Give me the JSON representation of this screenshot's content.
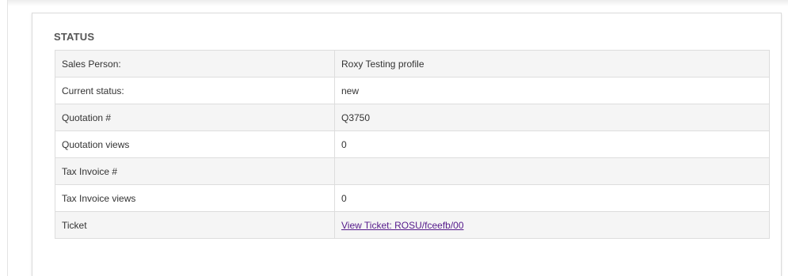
{
  "status_panel": {
    "title": "STATUS",
    "rows": [
      {
        "label": "Sales Person:",
        "value": "Roxy Testing profile"
      },
      {
        "label": "Current status:",
        "value": "new"
      },
      {
        "label": "Quotation #",
        "value": "Q3750"
      },
      {
        "label": "Quotation views",
        "value": "0"
      },
      {
        "label": "Tax Invoice #",
        "value": ""
      },
      {
        "label": "Tax Invoice views",
        "value": "0"
      },
      {
        "label": "Ticket",
        "value": "View Ticket: ROSU/fceefb/00"
      }
    ],
    "link_color": "#551a8b"
  }
}
